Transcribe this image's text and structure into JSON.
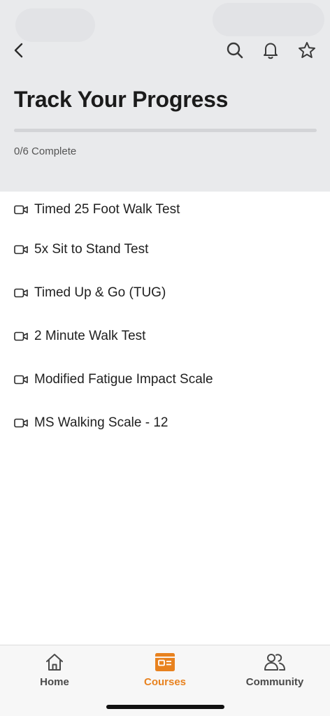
{
  "header": {
    "title": "Track Your Progress",
    "progress_text": "0/6 Complete",
    "progress_fraction": 0,
    "icons": {
      "back": "chevron-left-icon",
      "search": "search-icon",
      "notifications": "bell-icon",
      "favorite": "star-icon"
    }
  },
  "lessons": [
    {
      "label": "Timed 25 Foot Walk Test",
      "icon": "video-icon"
    },
    {
      "label": "5x Sit to Stand Test",
      "icon": "video-icon"
    },
    {
      "label": "Timed Up & Go (TUG)",
      "icon": "video-icon"
    },
    {
      "label": "2 Minute Walk Test",
      "icon": "video-icon"
    },
    {
      "label": "Modified Fatigue Impact Scale",
      "icon": "video-icon"
    },
    {
      "label": "MS Walking Scale - 12",
      "icon": "video-icon"
    }
  ],
  "tabbar": {
    "home": {
      "label": "Home",
      "icon": "home-icon"
    },
    "courses": {
      "label": "Courses",
      "icon": "courses-icon",
      "active": true
    },
    "community": {
      "label": "Community",
      "icon": "community-icon"
    }
  },
  "colors": {
    "accent": "#e8821f",
    "header_bg": "#e9eaec",
    "text": "#1f1f1f"
  }
}
